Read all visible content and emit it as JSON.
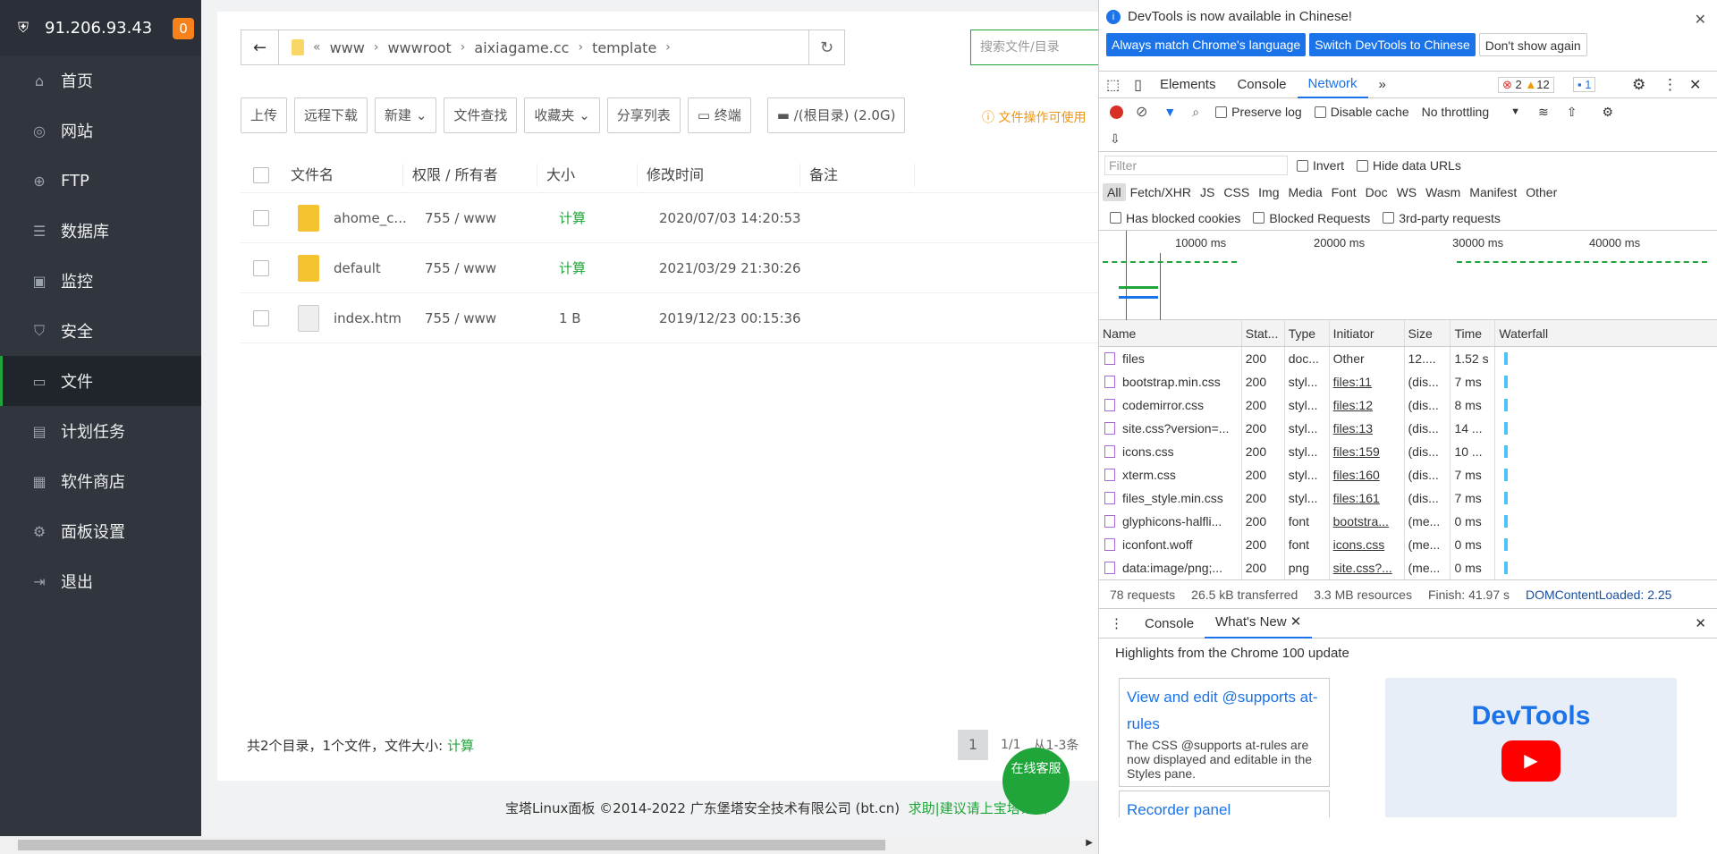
{
  "server": {
    "ip": "91.206.93.43",
    "badge": "0"
  },
  "nav": [
    {
      "label": "首页",
      "icon": "home-icon"
    },
    {
      "label": "网站",
      "icon": "globe-icon"
    },
    {
      "label": "FTP",
      "icon": "ftp-icon"
    },
    {
      "label": "数据库",
      "icon": "database-icon"
    },
    {
      "label": "监控",
      "icon": "monitor-icon"
    },
    {
      "label": "安全",
      "icon": "shield-icon"
    },
    {
      "label": "文件",
      "icon": "folder-icon"
    },
    {
      "label": "计划任务",
      "icon": "calendar-icon"
    },
    {
      "label": "软件商店",
      "icon": "apps-icon"
    },
    {
      "label": "面板设置",
      "icon": "gear-icon"
    },
    {
      "label": "退出",
      "icon": "logout-icon"
    }
  ],
  "path": {
    "segments": [
      "www",
      "wwwroot",
      "aixiagame.cc",
      "template"
    ],
    "search_placeholder": "搜索文件/目录"
  },
  "toolbar": {
    "upload": "上传",
    "remote": "远程下载",
    "new": "新建",
    "find": "文件查找",
    "favorites": "收藏夹",
    "share": "分享列表",
    "terminal": "终端",
    "disk": "/(根目录) (2.0G)",
    "warning": "文件操作可使用"
  },
  "table": {
    "headers": [
      "文件名",
      "权限 / 所有者",
      "大小",
      "修改时间",
      "备注"
    ],
    "rows": [
      {
        "name": "ahome_c...",
        "perm": "755 / www",
        "size": "计算",
        "mtime": "2020/07/03 14:20:53",
        "type": "folder"
      },
      {
        "name": "default",
        "perm": "755 / www",
        "size": "计算",
        "mtime": "2021/03/29 21:30:26",
        "type": "folder"
      },
      {
        "name": "index.htm",
        "perm": "755 / www",
        "size": "1 B",
        "mtime": "2019/12/23 00:15:36",
        "type": "file"
      }
    ]
  },
  "summary": {
    "text": "共2个目录，1个文件，文件大小:",
    "calc": "计算"
  },
  "pager": {
    "current": "1",
    "total": "1/1",
    "range": "从1-3条"
  },
  "footer": {
    "copyright": "宝塔Linux面板 ©2014-2022 广东堡塔安全技术有限公司 (bt.cn)",
    "help": "求助|建议请上宝塔论坛"
  },
  "online": "在线客服",
  "devtools": {
    "info": "DevTools is now available in Chinese!",
    "btn_match": "Always match Chrome's language",
    "btn_switch": "Switch DevTools to Chinese",
    "btn_dont": "Don't show again",
    "tabs": [
      "Elements",
      "Console",
      "Network"
    ],
    "errors": "2",
    "warnings": "12",
    "messages": "1",
    "preserve": "Preserve log",
    "disable_cache": "Disable cache",
    "throttle": "No throttling",
    "filter_placeholder": "Filter",
    "invert": "Invert",
    "hide_urls": "Hide data URLs",
    "types": [
      "All",
      "Fetch/XHR",
      "JS",
      "CSS",
      "Img",
      "Media",
      "Font",
      "Doc",
      "WS",
      "Wasm",
      "Manifest",
      "Other"
    ],
    "blocked_cookies": "Has blocked cookies",
    "blocked_requests": "Blocked Requests",
    "third_party": "3rd-party requests",
    "timeline_labels": [
      "10000 ms",
      "20000 ms",
      "30000 ms",
      "40000 ms"
    ],
    "columns": [
      "Name",
      "Stat...",
      "Type",
      "Initiator",
      "Size",
      "Time",
      "Waterfall"
    ],
    "requests": [
      {
        "name": "files",
        "status": "200",
        "type": "doc...",
        "init": "Other",
        "size": "12....",
        "time": "1.52 s"
      },
      {
        "name": "bootstrap.min.css",
        "status": "200",
        "type": "styl...",
        "init": "files:11",
        "size": "(dis...",
        "time": "7 ms"
      },
      {
        "name": "codemirror.css",
        "status": "200",
        "type": "styl...",
        "init": "files:12",
        "size": "(dis...",
        "time": "8 ms"
      },
      {
        "name": "site.css?version=...",
        "status": "200",
        "type": "styl...",
        "init": "files:13",
        "size": "(dis...",
        "time": "14 ..."
      },
      {
        "name": "icons.css",
        "status": "200",
        "type": "styl...",
        "init": "files:159",
        "size": "(dis...",
        "time": "10 ..."
      },
      {
        "name": "xterm.css",
        "status": "200",
        "type": "styl...",
        "init": "files:160",
        "size": "(dis...",
        "time": "7 ms"
      },
      {
        "name": "files_style.min.css",
        "status": "200",
        "type": "styl...",
        "init": "files:161",
        "size": "(dis...",
        "time": "7 ms"
      },
      {
        "name": "glyphicons-halfli...",
        "status": "200",
        "type": "font",
        "init": "bootstra...",
        "size": "(me...",
        "time": "0 ms"
      },
      {
        "name": "iconfont.woff",
        "status": "200",
        "type": "font",
        "init": "icons.css",
        "size": "(me...",
        "time": "0 ms"
      },
      {
        "name": "data:image/png;...",
        "status": "200",
        "type": "png",
        "init": "site.css?...",
        "size": "(me...",
        "time": "0 ms"
      }
    ],
    "statusbar": {
      "requests": "78 requests",
      "transferred": "26.5 kB transferred",
      "resources": "3.3 MB resources",
      "finish": "Finish: 41.97 s",
      "dcl": "DOMContentLoaded: 2.25"
    },
    "drawer_tabs": [
      "Console",
      "What's New"
    ],
    "whats_new": "Highlights from the Chrome 100 update",
    "card1_title": "View and edit @supports at-rules",
    "card1_desc": "The CSS @supports at-rules are now displayed and editable in the Styles pane.",
    "card2_title": "Recorder panel",
    "promo": "DevTools"
  }
}
